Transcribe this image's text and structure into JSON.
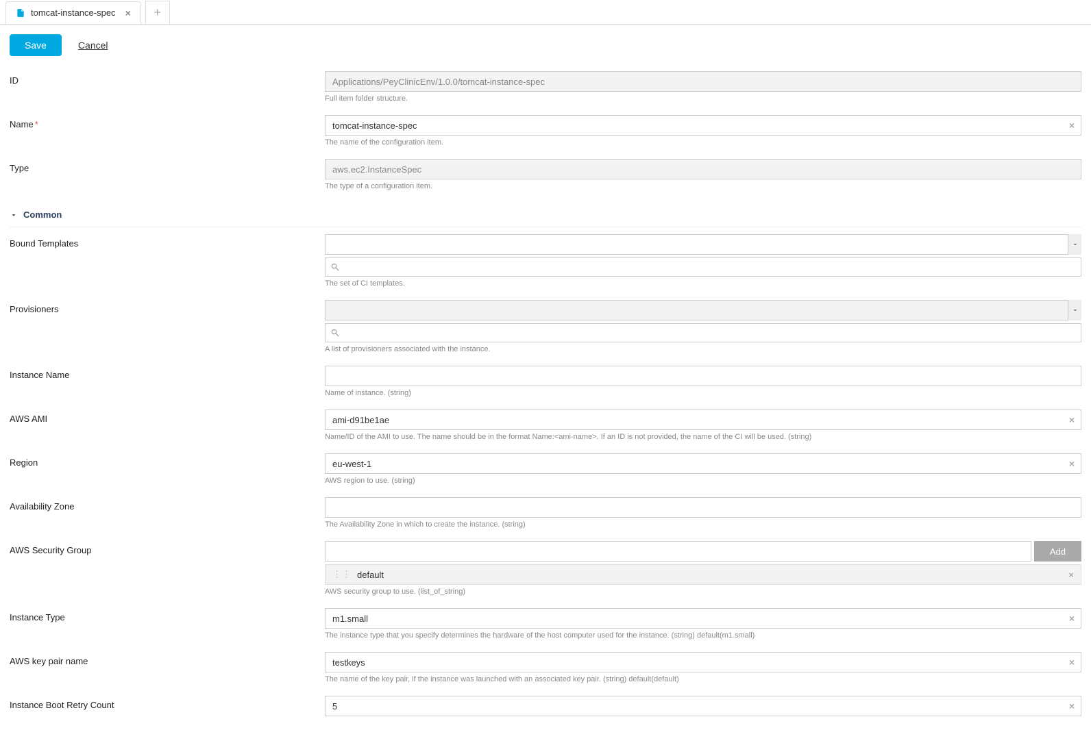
{
  "tab": {
    "title": "tomcat-instance-spec"
  },
  "actions": {
    "save": "Save",
    "cancel": "Cancel",
    "add": "Add"
  },
  "section": {
    "common": "Common"
  },
  "fields": {
    "id": {
      "label": "ID",
      "value": "Applications/PeyClinicEnv/1.0.0/tomcat-instance-spec",
      "hint": "Full item folder structure."
    },
    "name": {
      "label": "Name",
      "value": "tomcat-instance-spec",
      "hint": "The name of the configuration item."
    },
    "type": {
      "label": "Type",
      "value": "aws.ec2.InstanceSpec",
      "hint": "The type of a configuration item."
    },
    "bound_templates": {
      "label": "Bound Templates",
      "hint": "The set of CI templates."
    },
    "provisioners": {
      "label": "Provisioners",
      "hint": "A list of provisioners associated with the instance."
    },
    "instance_name": {
      "label": "Instance Name",
      "hint": "Name of instance. (string)"
    },
    "aws_ami": {
      "label": "AWS AMI",
      "value": "ami-d91be1ae",
      "hint": "Name/ID of the AMI to use. The name should be in the format Name:<ami-name>. If an ID is not provided, the name of the CI will be used. (string)"
    },
    "region": {
      "label": "Region",
      "value": "eu-west-1",
      "hint": "AWS region to use. (string)"
    },
    "availability_zone": {
      "label": "Availability Zone",
      "hint": "The Availability Zone in which to create the instance. (string)"
    },
    "security_group": {
      "label": "AWS Security Group",
      "tag": "default",
      "hint": "AWS security group to use. (list_of_string)"
    },
    "instance_type": {
      "label": "Instance Type",
      "value": "m1.small",
      "hint": "The instance type that you specify determines the hardware of the host computer used for the instance. (string) default(m1.small)"
    },
    "key_pair": {
      "label": "AWS key pair name",
      "value": "testkeys",
      "hint": "The name of the key pair, if the instance was launched with an associated key pair. (string) default(default)"
    },
    "boot_retry": {
      "label": "Instance Boot Retry Count",
      "value": "5"
    }
  }
}
